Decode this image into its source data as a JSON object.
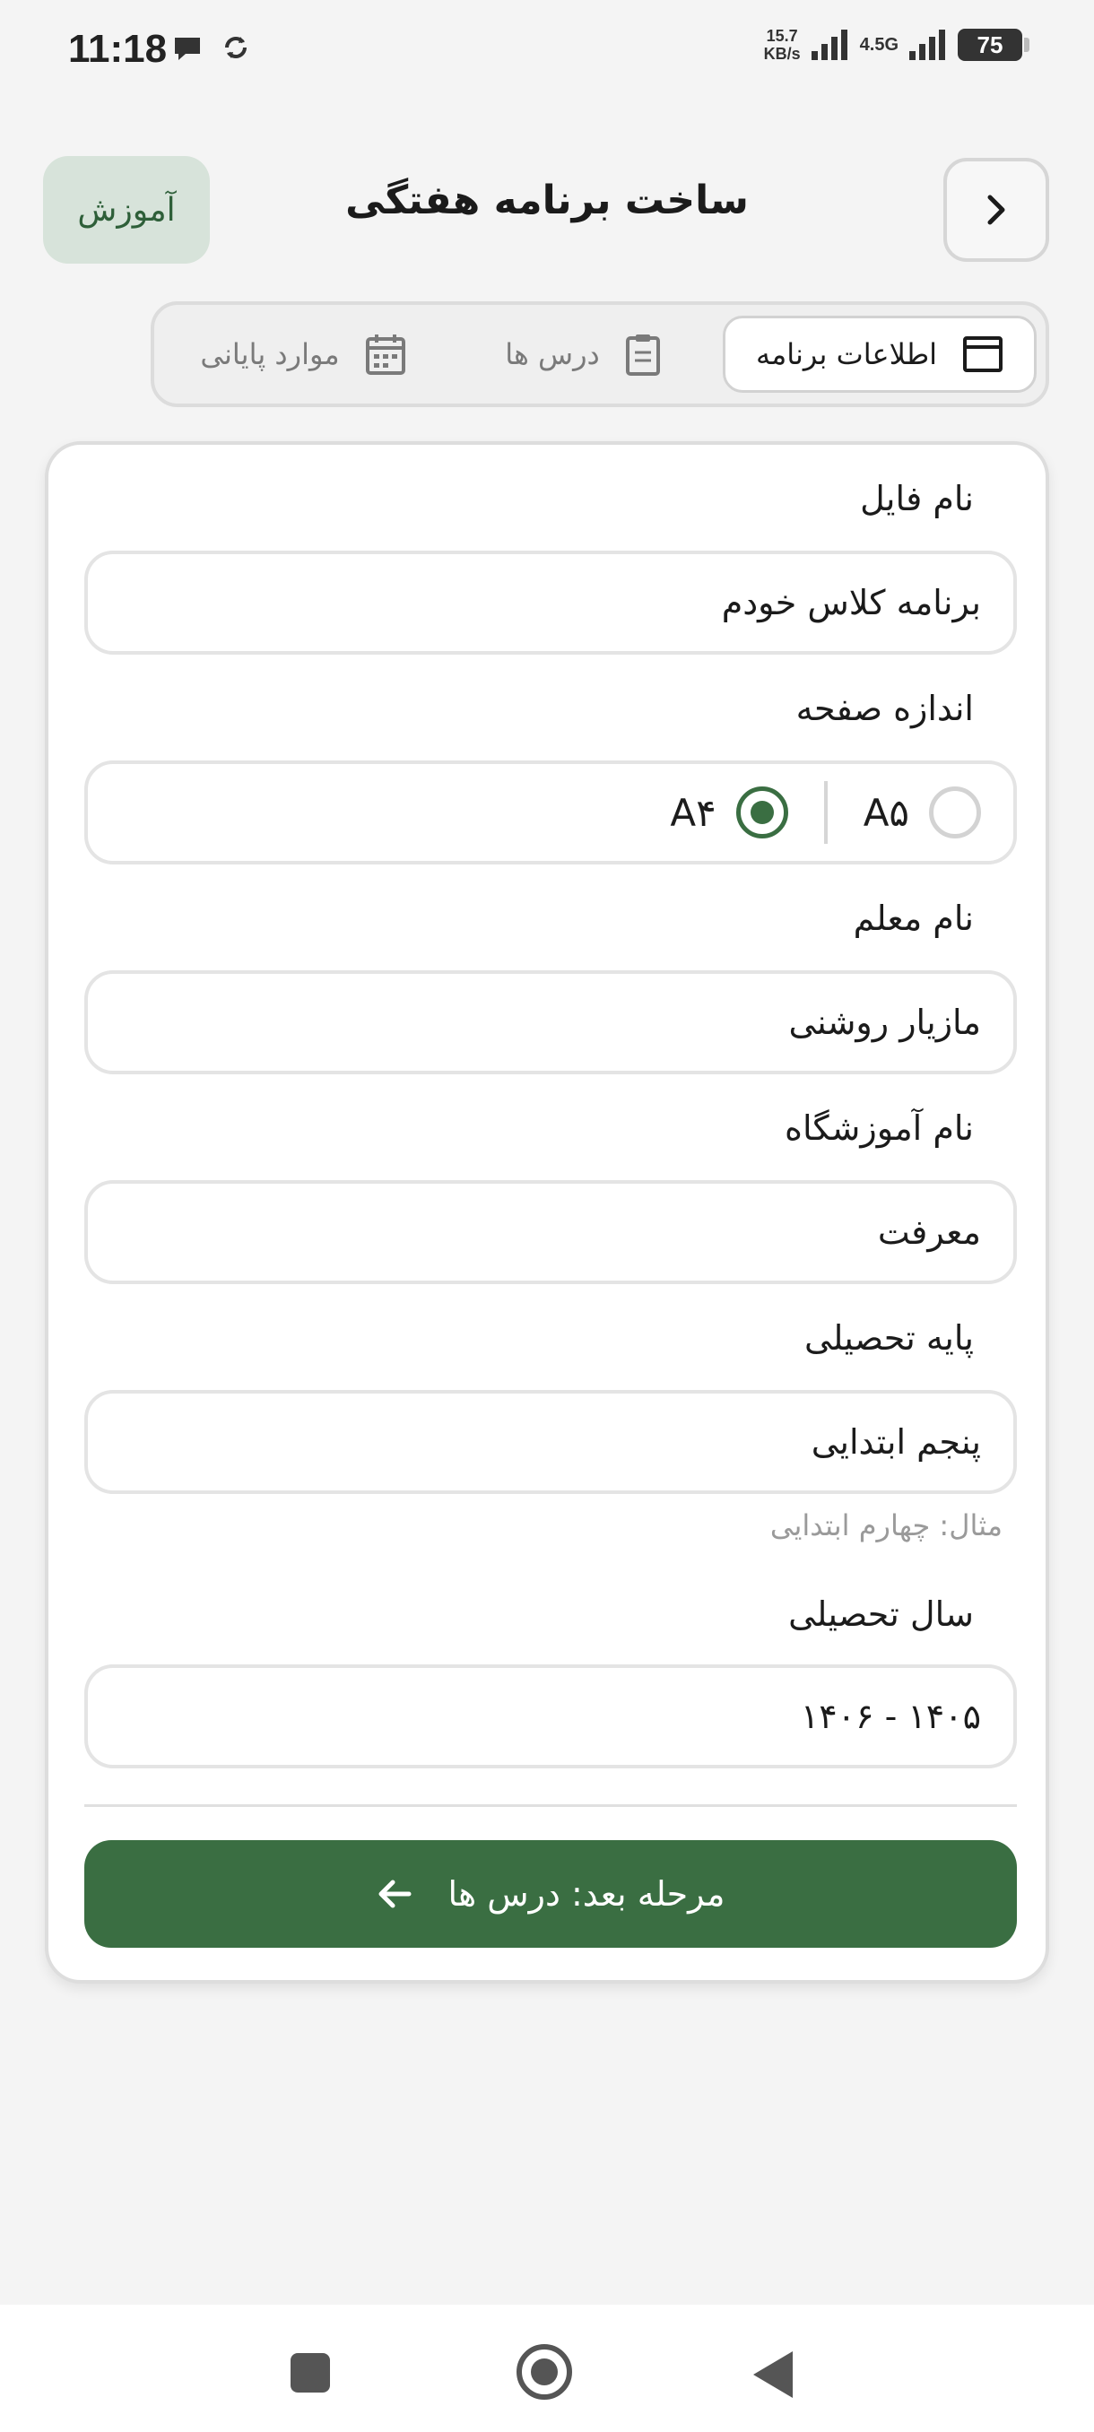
{
  "status_bar": {
    "time": "11:18",
    "net_speed_value": "15.7",
    "net_speed_unit": "KB/s",
    "network_type": "4.5G",
    "battery": "75"
  },
  "header": {
    "title": "ساخت برنامه هفتگی",
    "tutorial_label": "آموزش"
  },
  "tabs": [
    {
      "label": "اطلاعات برنامه",
      "icon": "window-icon",
      "active": true
    },
    {
      "label": "درس ها",
      "icon": "clipboard-icon",
      "active": false
    },
    {
      "label": "موارد پایانی",
      "icon": "calendar-icon",
      "active": false
    }
  ],
  "form": {
    "file_name": {
      "label": "نام فایل",
      "value": "برنامه کلاس خودم"
    },
    "page_size": {
      "label": "اندازه صفحه",
      "options": [
        {
          "label": "A۵",
          "selected": false
        },
        {
          "label": "A۴",
          "selected": true
        }
      ]
    },
    "teacher_name": {
      "label": "نام معلم",
      "value": "مازیار روشنی"
    },
    "school_name": {
      "label": "نام آموزشگاه",
      "value": "معرفت"
    },
    "grade": {
      "label": "پایه تحصیلی",
      "value": "پنجم ابتدایی",
      "hint": "مثال: چهارم ابتدایی"
    },
    "academic_year": {
      "label": "سال تحصیلی",
      "value": "۱۴۰۵ - ۱۴۰۶"
    }
  },
  "next_button": {
    "label": "مرحله بعد: درس ها",
    "icon": "arrow-left-icon"
  },
  "colors": {
    "accent": "#3a6e42",
    "tutorial_bg": "#d7e3da"
  }
}
